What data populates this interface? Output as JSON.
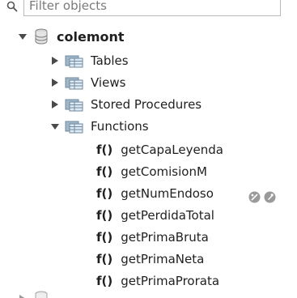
{
  "filter": {
    "placeholder": "Filter objects"
  },
  "schema": {
    "name": "colemont"
  },
  "folders": [
    {
      "label": "Tables"
    },
    {
      "label": "Views"
    },
    {
      "label": "Stored Procedures"
    },
    {
      "label": "Functions"
    }
  ],
  "functions": [
    {
      "prefix": "f()",
      "name": "getCapaLeyenda"
    },
    {
      "prefix": "f()",
      "name": "getComisionM"
    },
    {
      "prefix": "f()",
      "name": "getNumEndoso"
    },
    {
      "prefix": "f()",
      "name": "getPerdidaTotal"
    },
    {
      "prefix": "f()",
      "name": "getPrimaBruta"
    },
    {
      "prefix": "f()",
      "name": "getPrimaNeta"
    },
    {
      "prefix": "f()",
      "name": "getPrimaProrata"
    }
  ],
  "icons": {
    "filter": "search-icon",
    "schema": "database-icon",
    "folder": "folder-table-icon",
    "info": "info-icon",
    "edit": "wrench-icon"
  }
}
